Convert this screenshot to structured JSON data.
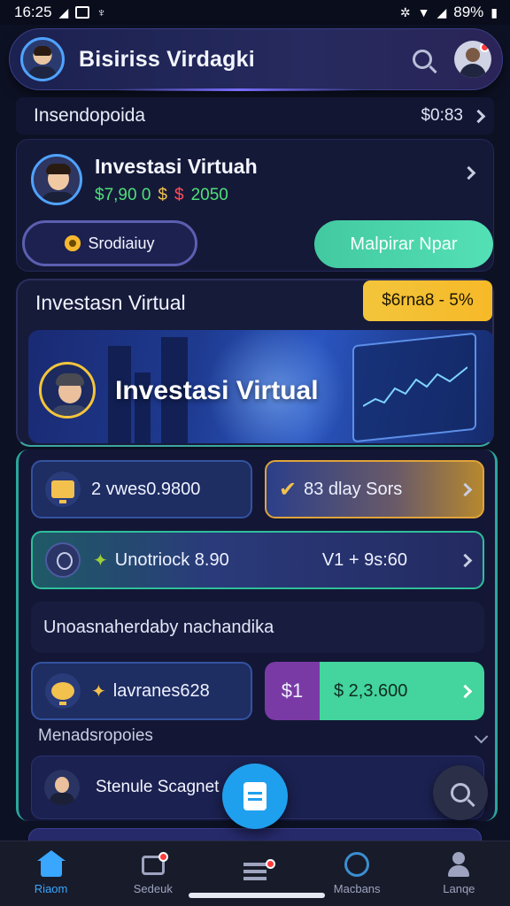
{
  "status_bar": {
    "time": "16:25",
    "battery": "89%"
  },
  "header": {
    "title": "Bisiriss Virdagki"
  },
  "summary_row": {
    "label": "Insendopoida",
    "value": "$0:83"
  },
  "account": {
    "title": "Investasi Virtuah",
    "value_green": "$7,90 0",
    "value_red": "2050",
    "secondary_button": "Srodiaiuy",
    "primary_button": "Malpirar Npar"
  },
  "hero": {
    "title": "Investasn Virtual",
    "badge": "$6rna8 - 5%",
    "banner_text": "Investasi Virtual"
  },
  "tiles": {
    "tile1": "2 vwes0.9800",
    "tile2": "83 dlay Sors",
    "tile3_left": "Unotriock 8.90",
    "tile3_right": "V1 + 9s:60",
    "tile4": "Unoasnaherdaby nachandika",
    "tile5": "lavranes628",
    "tile6_left": "$1",
    "tile6_right": "$ 2,3.600"
  },
  "section": {
    "title": "Menadsropoies"
  },
  "list_item": {
    "label": "Stenule Scagnet"
  },
  "bottom_nav": [
    {
      "label": "Riaom",
      "active": true
    },
    {
      "label": "Sedeuk",
      "active": false
    },
    {
      "label": "",
      "active": false
    },
    {
      "label": "Macbans",
      "active": false
    },
    {
      "label": "Lanqe",
      "active": false
    }
  ],
  "colors": {
    "accent_blue": "#39a6ff",
    "accent_green": "#44d49d",
    "badge_gold": "#f3c53b",
    "background": "#0d1124"
  }
}
